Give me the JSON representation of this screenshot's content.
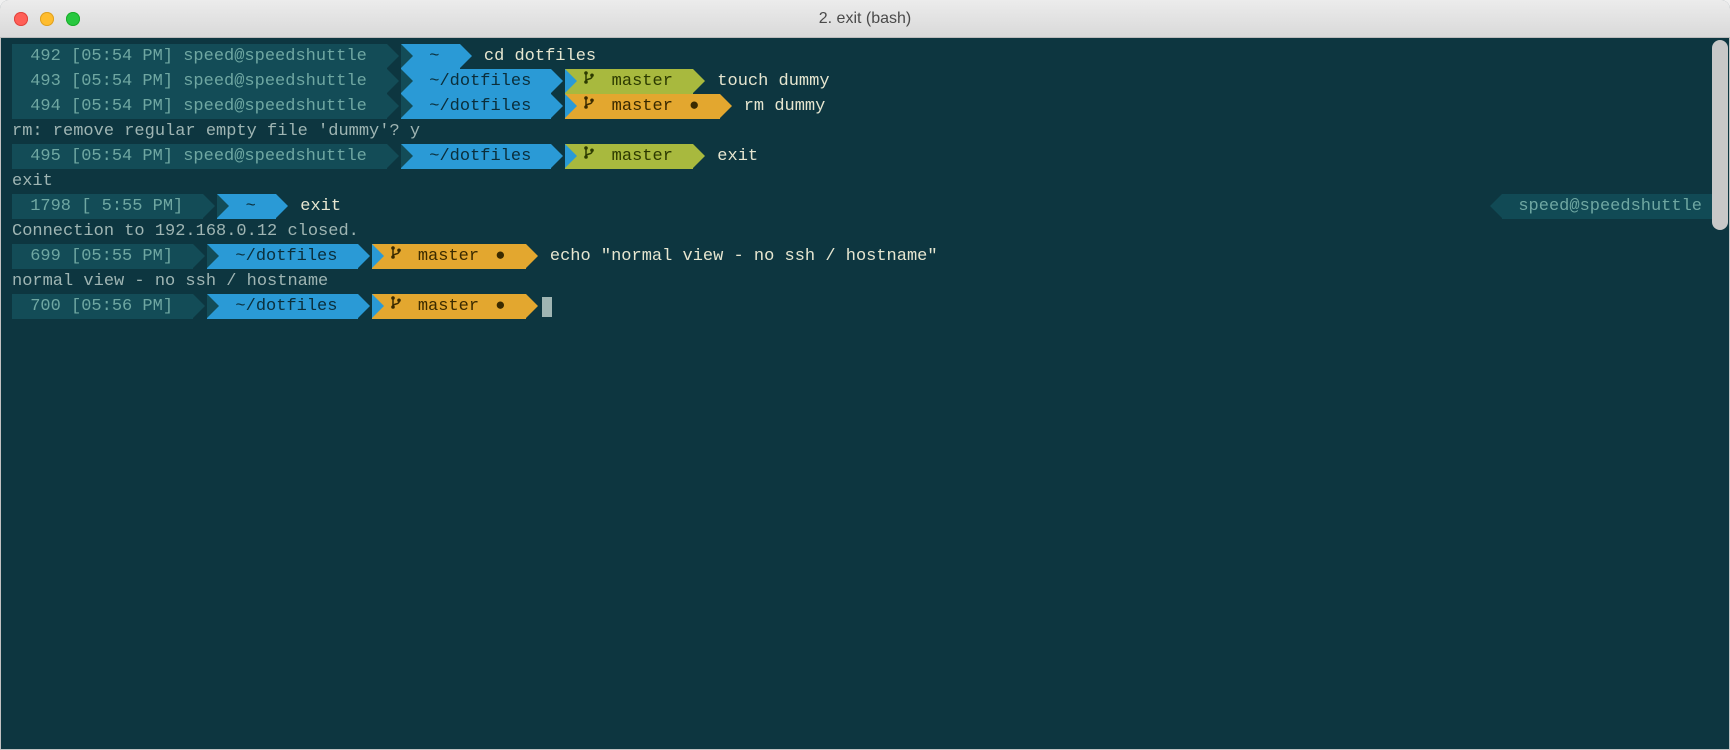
{
  "window": {
    "title": "2. exit (bash)"
  },
  "colors": {
    "bg": "#0d3640",
    "teal": "#134c57",
    "blue": "#2a9ad6",
    "olive": "#a8b93e",
    "gold": "#e3a72f"
  },
  "rprompt": "speed@speedshuttle",
  "lines": [
    {
      "type": "prompt",
      "num": "492",
      "time": "[05:54 PM]",
      "userhost": "speed@speedshuttle",
      "cwd": "~",
      "branch": null,
      "dirty": false,
      "command": "cd dotfiles"
    },
    {
      "type": "prompt",
      "num": "493",
      "time": "[05:54 PM]",
      "userhost": "speed@speedshuttle",
      "cwd": "~/dotfiles",
      "branch": "master",
      "branchColor": "olive",
      "dirty": false,
      "command": "touch dummy"
    },
    {
      "type": "prompt",
      "num": "494",
      "time": "[05:54 PM]",
      "userhost": "speed@speedshuttle",
      "cwd": "~/dotfiles",
      "branch": "master",
      "branchColor": "gold",
      "dirty": true,
      "command": "rm dummy"
    },
    {
      "type": "output",
      "text": "rm: remove regular empty file 'dummy'? y"
    },
    {
      "type": "prompt",
      "num": "495",
      "time": "[05:54 PM]",
      "userhost": "speed@speedshuttle",
      "cwd": "~/dotfiles",
      "branch": "master",
      "branchColor": "olive",
      "dirty": false,
      "command": "exit"
    },
    {
      "type": "output",
      "text": "exit"
    },
    {
      "type": "prompt",
      "num": "1798",
      "time": "[ 5:55 PM]",
      "userhost": null,
      "cwd": "~",
      "branch": null,
      "dirty": false,
      "command": "exit",
      "rprompt": true
    },
    {
      "type": "output",
      "text": "Connection to 192.168.0.12 closed."
    },
    {
      "type": "prompt",
      "num": "699",
      "time": "[05:55 PM]",
      "userhost": null,
      "cwd": "~/dotfiles",
      "branch": "master",
      "branchColor": "gold",
      "dirty": true,
      "command": "echo \"normal view - no ssh / hostname\""
    },
    {
      "type": "output",
      "text": "normal view - no ssh / hostname"
    },
    {
      "type": "prompt",
      "num": "700",
      "time": "[05:56 PM]",
      "userhost": null,
      "cwd": "~/dotfiles",
      "branch": "master",
      "branchColor": "gold",
      "dirty": true,
      "command": "",
      "cursor": true
    }
  ]
}
